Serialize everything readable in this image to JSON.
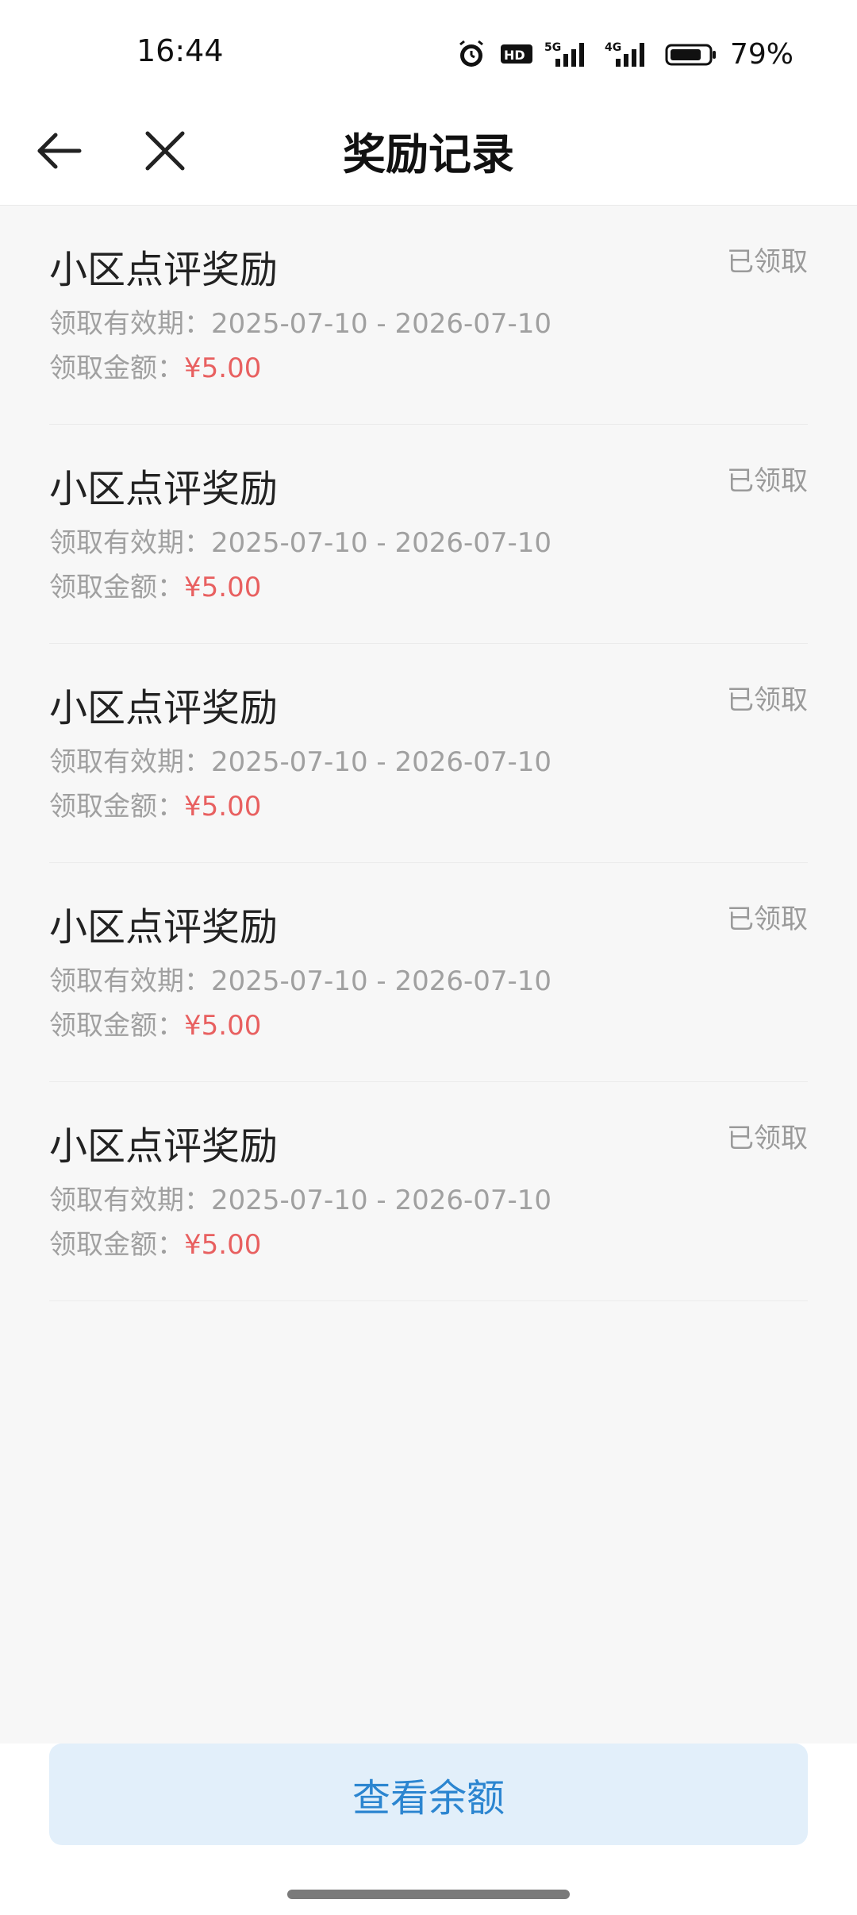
{
  "status_bar": {
    "time": "16:44",
    "battery": "79%",
    "icons": [
      "alarm-icon",
      "hd-icon",
      "signal-5g-icon",
      "signal-4g-icon",
      "battery-icon"
    ]
  },
  "header": {
    "title": "奖励记录",
    "back_icon": "arrow-left-icon",
    "close_icon": "close-icon"
  },
  "records": [
    {
      "title": "小区点评奖励",
      "status": "已领取",
      "validity_label": "领取有效期：",
      "validity": "2025-07-10 - 2026-07-10",
      "amount_label": "领取金额：",
      "amount": "¥5.00"
    },
    {
      "title": "小区点评奖励",
      "status": "已领取",
      "validity_label": "领取有效期：",
      "validity": "2025-07-10 - 2026-07-10",
      "amount_label": "领取金额：",
      "amount": "¥5.00"
    },
    {
      "title": "小区点评奖励",
      "status": "已领取",
      "validity_label": "领取有效期：",
      "validity": "2025-07-10 - 2026-07-10",
      "amount_label": "领取金额：",
      "amount": "¥5.00"
    },
    {
      "title": "小区点评奖励",
      "status": "已领取",
      "validity_label": "领取有效期：",
      "validity": "2025-07-10 - 2026-07-10",
      "amount_label": "领取金额：",
      "amount": "¥5.00"
    },
    {
      "title": "小区点评奖励",
      "status": "已领取",
      "validity_label": "领取有效期：",
      "validity": "2025-07-10 - 2026-07-10",
      "amount_label": "领取金额：",
      "amount": "¥5.00"
    }
  ],
  "footer": {
    "balance_button_label": "查看余额"
  },
  "colors": {
    "amount": "#e86060",
    "button_bg": "#e2effa",
    "button_text": "#2b85d0",
    "page_bg": "#f7f7f7"
  }
}
